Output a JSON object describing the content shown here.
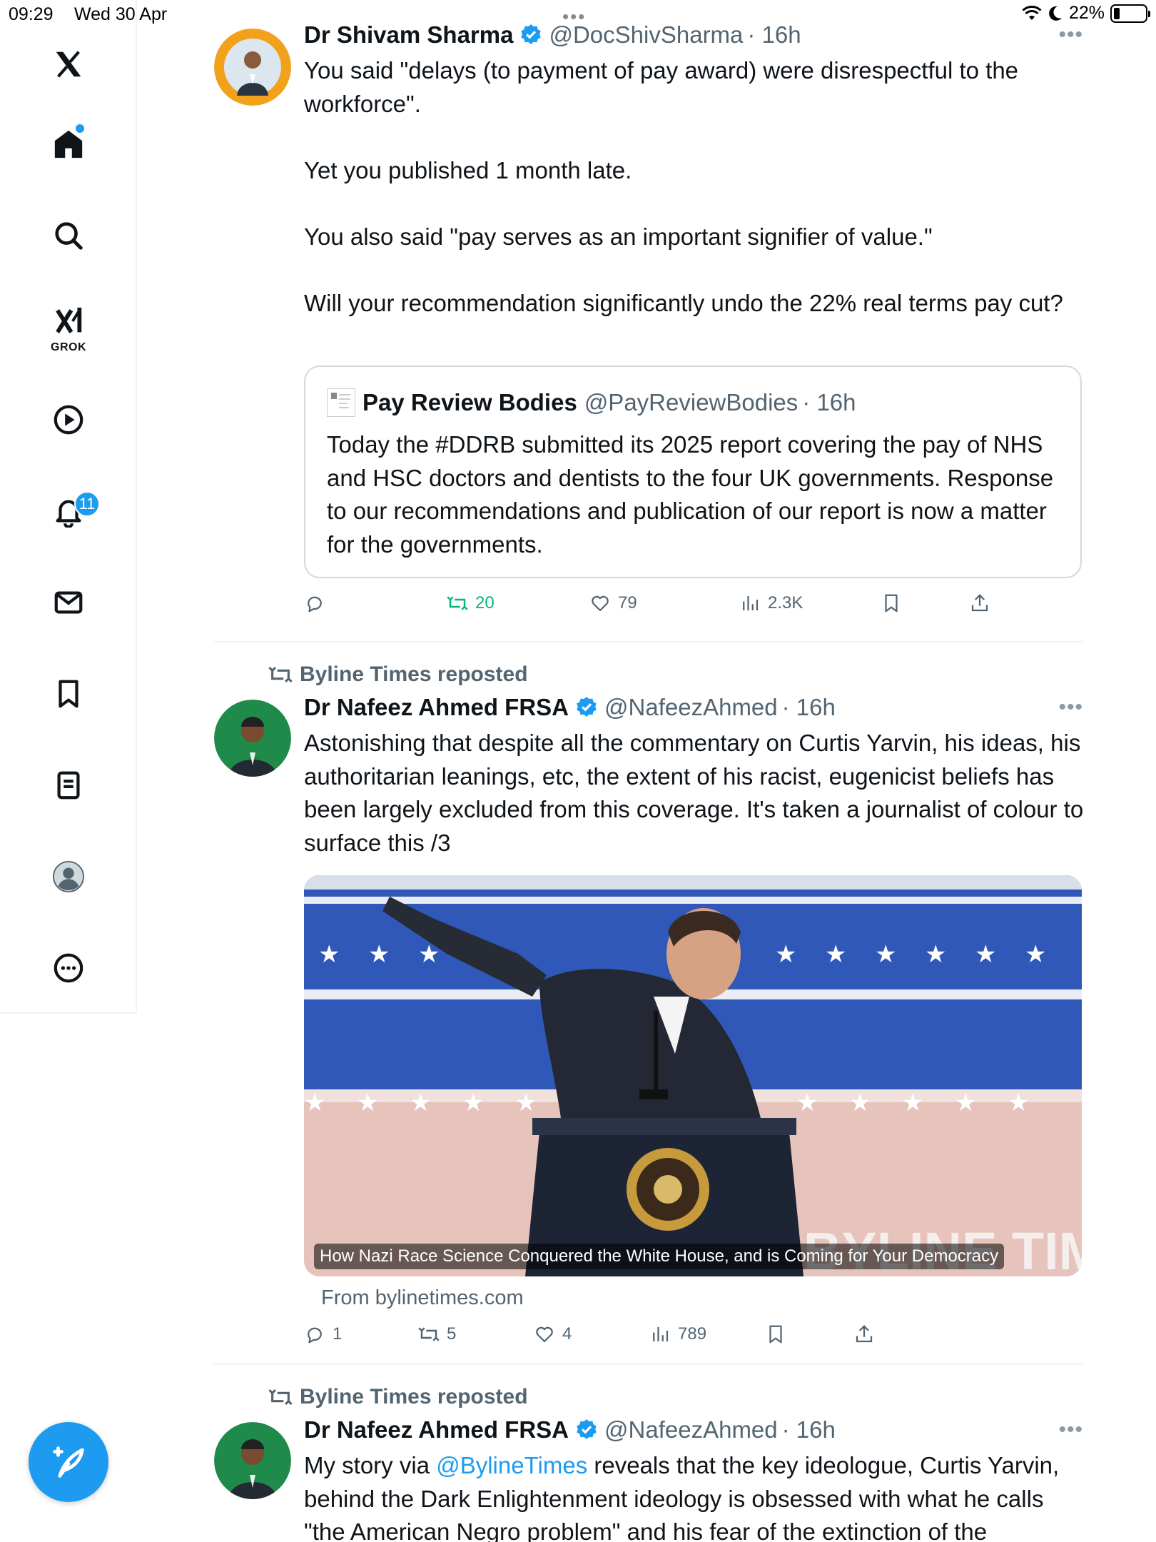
{
  "status_bar": {
    "time": "09:29",
    "date": "Wed 30 Apr",
    "battery": "22%"
  },
  "sidebar": {
    "grok_label": "GROK",
    "notifications_count": "11",
    "items": [
      "x-logo",
      "home-icon",
      "search-icon",
      "grok-icon",
      "video-icon",
      "notifications-icon",
      "messages-icon",
      "bookmarks-icon",
      "lists-icon",
      "profile-icon",
      "more-icon"
    ]
  },
  "tweets": [
    {
      "name": "Dr Shivam Sharma",
      "handle": "@DocShivSharma",
      "time": "· 16h",
      "text": "You said \"delays (to payment of pay award) were disrespectful to the workforce\".\n\nYet you published 1 month late.\n\nYou also said \"pay serves as an important signifier of value.\"\n\nWill your recommendation significantly undo the 22% real terms pay cut?",
      "quote": {
        "name": "Pay Review Bodies",
        "handle": "@PayReviewBodies",
        "time": "· 16h",
        "text": "Today the #DDRB submitted its 2025 report covering the pay of NHS and HSC doctors and dentists to the four UK governments. Response to our recommendations and publication of our report is now a matter for the governments."
      },
      "stats": {
        "replies": "",
        "reposts": "20",
        "likes": "79",
        "views": "2.3K"
      }
    },
    {
      "reposted_by": "Byline Times reposted",
      "name": "Dr Nafeez Ahmed FRSA",
      "handle": "@NafeezAhmed",
      "time": "· 16h",
      "text": "Astonishing that despite all the commentary on Curtis Yarvin, his ideas, his authoritarian leanings, etc, the extent of his racist, eugenicist beliefs has been largely excluded from this coverage. It's taken a journalist of colour to surface this /3",
      "card": {
        "title": "How Nazi Race Science Conquered the White House, and is Coming for Your Democracy",
        "source": "From bylinetimes.com",
        "watermark": "BYLINE TIMES"
      },
      "stats": {
        "replies": "1",
        "reposts": "5",
        "likes": "4",
        "views": "789"
      }
    },
    {
      "reposted_by": "Byline Times reposted",
      "name": "Dr Nafeez Ahmed FRSA",
      "handle": "@NafeezAhmed",
      "time": "· 16h",
      "text_pre": "My story via ",
      "text_link": "@BylineTimes",
      "text_post": " reveals that the key ideologue, Curtis Yarvin, behind the Dark Enlightenment ideology is obsessed with what he calls \"the American Negro problem\" and his fear of the extinction of the"
    }
  ],
  "colors": {
    "accent": "#1d9bf0",
    "repost_green": "#00ba7c",
    "muted": "#536471"
  }
}
